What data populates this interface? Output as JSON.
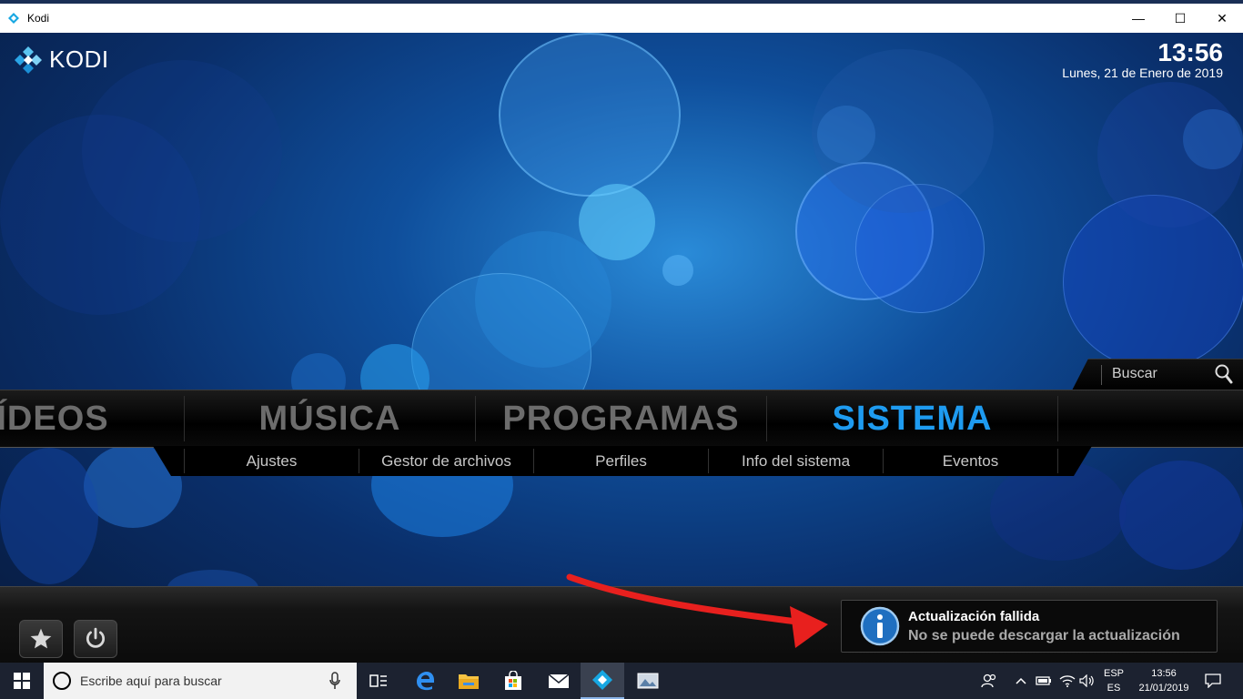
{
  "window": {
    "title": "Kodi",
    "minimize": "—",
    "maximize": "☐",
    "close": "✕"
  },
  "kodi": {
    "logo_text": "KODI",
    "clock": {
      "time": "13:56",
      "date": "Lunes, 21 de Enero de 2019"
    },
    "search": {
      "label": "Buscar"
    },
    "main_menu": [
      {
        "label": "ÍDEOS",
        "active": false
      },
      {
        "label": "MÚSICA",
        "active": false
      },
      {
        "label": "PROGRAMAS",
        "active": false
      },
      {
        "label": "SISTEMA",
        "active": true
      }
    ],
    "sub_menu": [
      "Ajustes",
      "Gestor de archivos",
      "Perfiles",
      "Info del sistema",
      "Eventos"
    ],
    "bottom_buttons": [
      "favourites-star",
      "power"
    ],
    "notification": {
      "title": "Actualización fallida",
      "message": "No se puede descargar la actualización",
      "icon": "info-icon"
    },
    "colors": {
      "accent": "#1e9bf0",
      "annotation_arrow": "#e8201e"
    }
  },
  "taskbar": {
    "search_placeholder": "Escribe aquí para buscar",
    "pinned": [
      "task-view",
      "edge",
      "file-explorer",
      "store",
      "mail",
      "kodi",
      "photos"
    ],
    "language": {
      "top": "ESP",
      "bottom": "ES"
    },
    "clock": {
      "time": "13:56",
      "date": "21/01/2019"
    }
  }
}
